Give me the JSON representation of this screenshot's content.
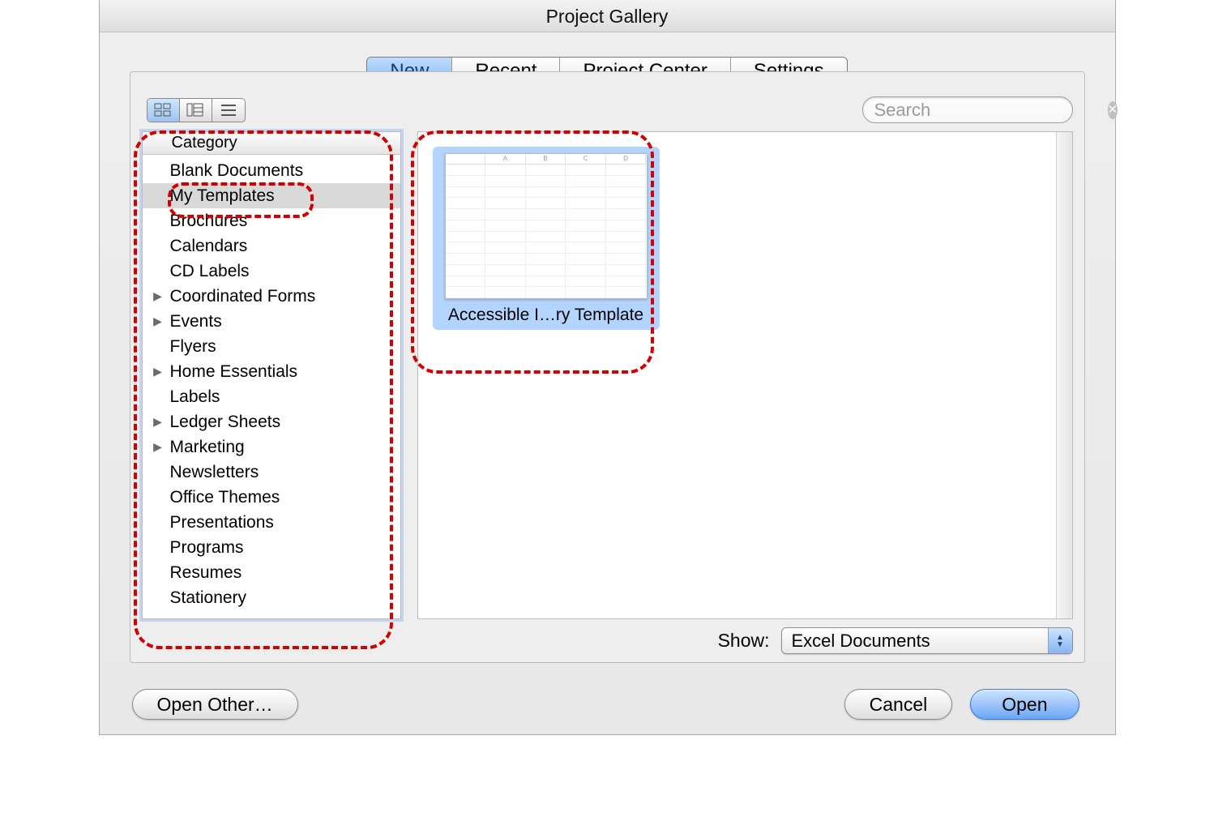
{
  "window_title": "Project Gallery",
  "tabs": [
    "New",
    "Recent",
    "Project Center",
    "Settings"
  ],
  "search_placeholder": "Search",
  "category_header": "Category",
  "categories": [
    {
      "label": "Blank Documents",
      "expandable": false
    },
    {
      "label": "My Templates",
      "expandable": false,
      "selected": true
    },
    {
      "label": "Brochures",
      "expandable": false
    },
    {
      "label": "Calendars",
      "expandable": false
    },
    {
      "label": "CD Labels",
      "expandable": false
    },
    {
      "label": "Coordinated Forms",
      "expandable": true
    },
    {
      "label": "Events",
      "expandable": true
    },
    {
      "label": "Flyers",
      "expandable": false
    },
    {
      "label": "Home Essentials",
      "expandable": true
    },
    {
      "label": "Labels",
      "expandable": false
    },
    {
      "label": "Ledger Sheets",
      "expandable": true
    },
    {
      "label": "Marketing",
      "expandable": true
    },
    {
      "label": "Newsletters",
      "expandable": false
    },
    {
      "label": "Office Themes",
      "expandable": false
    },
    {
      "label": "Presentations",
      "expandable": false
    },
    {
      "label": "Programs",
      "expandable": false
    },
    {
      "label": "Resumes",
      "expandable": false
    },
    {
      "label": "Stationery",
      "expandable": false
    }
  ],
  "templates": [
    {
      "label": "Accessible I…ry Template",
      "selected": true
    }
  ],
  "show_label": "Show:",
  "show_value": "Excel Documents",
  "buttons": {
    "open_other": "Open Other…",
    "cancel": "Cancel",
    "open": "Open"
  }
}
